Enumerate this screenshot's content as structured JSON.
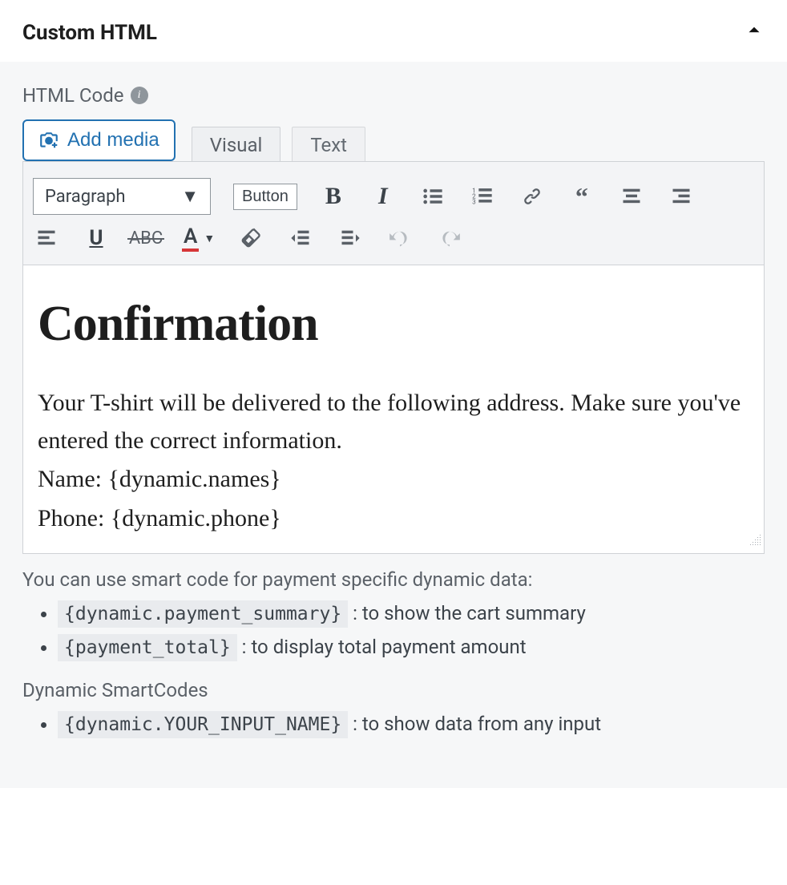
{
  "panel": {
    "title": "Custom HTML"
  },
  "field": {
    "label": "HTML Code"
  },
  "media": {
    "add_label": "Add media"
  },
  "tabs": {
    "visual": "Visual",
    "text": "Text"
  },
  "toolbar": {
    "paragraph_label": "Paragraph",
    "button_label": "Button"
  },
  "content": {
    "heading": "Confirmation",
    "line1": "Your T-shirt will be delivered to the following address. Make sure you've entered the correct information.",
    "line2": "Name: {dynamic.names}",
    "line3": "Phone: {dynamic.phone}"
  },
  "hint": {
    "intro": "You can use smart code for payment specific dynamic data:",
    "items": [
      {
        "code": "{dynamic.payment_summary}",
        "desc": ": to show the cart summary"
      },
      {
        "code": "{payment_total}",
        "desc": ": to display total payment amount"
      }
    ],
    "dynamic_heading": "Dynamic SmartCodes",
    "dynamic_items": [
      {
        "code": "{dynamic.YOUR_INPUT_NAME}",
        "desc": ": to show data from any input"
      }
    ]
  }
}
